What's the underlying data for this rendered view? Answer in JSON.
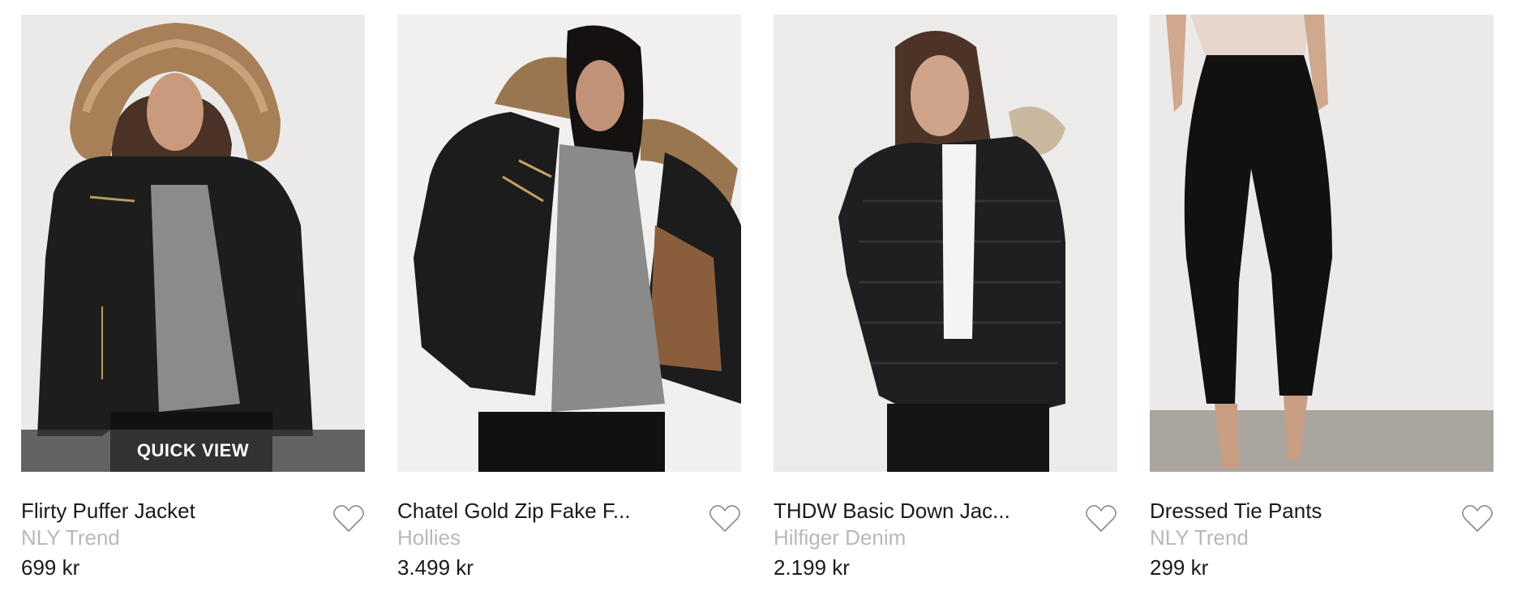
{
  "products": [
    {
      "name": "Flirty Puffer Jacket",
      "brand": "NLY Trend",
      "price": "699 kr",
      "image": "woman-black-puffer-fur-hood",
      "quick_view": "QUICK VIEW"
    },
    {
      "name": "Chatel Gold Zip Fake F...",
      "brand": "Hollies",
      "price": "3.499 kr",
      "image": "woman-black-jacket-leopard-lining"
    },
    {
      "name": "THDW Basic Down Jac...",
      "brand": "Hilfiger Denim",
      "price": "2.199 kr",
      "image": "woman-black-down-jacket"
    },
    {
      "name": "Dressed Tie Pants",
      "brand": "NLY Trend",
      "price": "299 kr",
      "image": "black-tie-pants"
    }
  ],
  "icons": {
    "wishlist": "heart-outline-icon"
  },
  "colors": {
    "brand_text": "#b8b8b8",
    "text": "#1a1a1a",
    "quick_view_bg": "#3c3c3c"
  }
}
